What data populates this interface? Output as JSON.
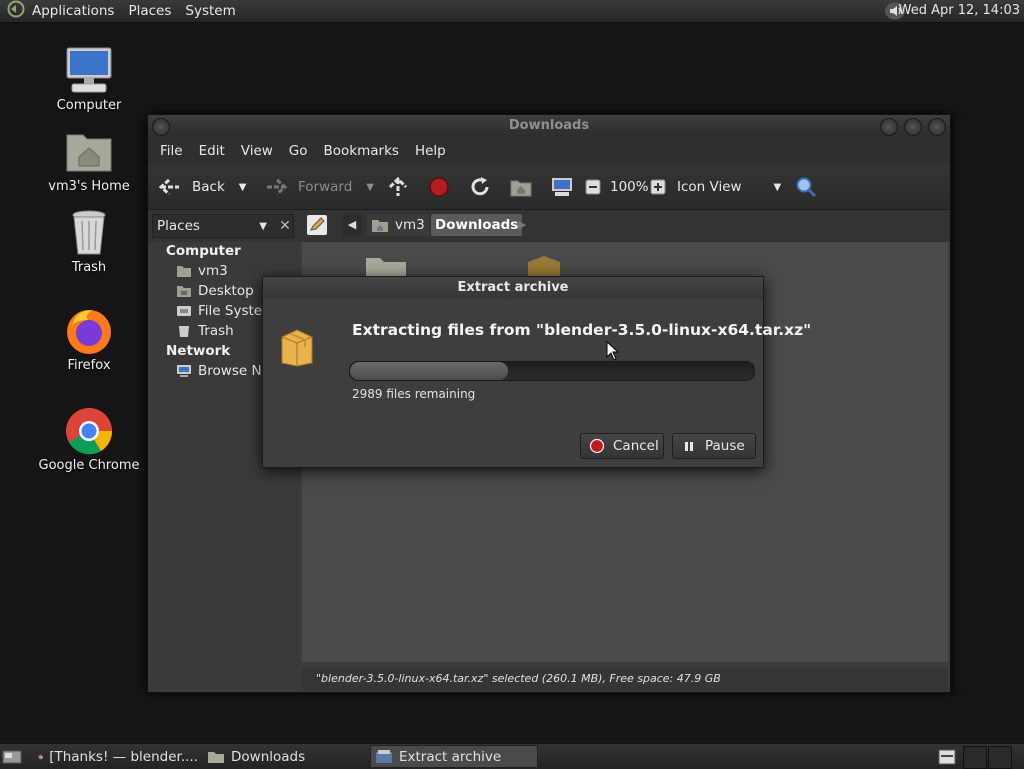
{
  "top_panel": {
    "menus": [
      "Applications",
      "Places",
      "System"
    ],
    "clock": "Wed Apr 12, 14:03"
  },
  "desktop_icons": [
    "Computer",
    "vm3's Home",
    "Trash",
    "Firefox",
    "Google Chrome"
  ],
  "file_manager": {
    "title": "Downloads",
    "menus": [
      "File",
      "Edit",
      "View",
      "Go",
      "Bookmarks",
      "Help"
    ],
    "toolbar": {
      "back": "Back",
      "forward": "Forward",
      "zoom": "100%",
      "view_mode": "Icon View"
    },
    "sidebar": {
      "selector": "Places",
      "computer_heading": "Computer",
      "computer_items": [
        "vm3",
        "Desktop",
        "File System",
        "Trash"
      ],
      "network_heading": "Network",
      "network_items": [
        "Browse Network"
      ]
    },
    "path": [
      "vm3",
      "Downloads"
    ],
    "status": "\"blender-3.5.0-linux-x64.tar.xz\" selected (260.1 MB), Free space: 47.9 GB"
  },
  "extract_dialog": {
    "title": "Extract archive",
    "heading": "Extracting files from \"blender-3.5.0-linux-x64.tar.xz\"",
    "progress": 0.39,
    "remaining": "2989 files remaining",
    "cancel": "Cancel",
    "pause": "Pause"
  },
  "taskbar": {
    "items": [
      "[Thanks! — blender....",
      "Downloads",
      "Extract archive"
    ]
  }
}
